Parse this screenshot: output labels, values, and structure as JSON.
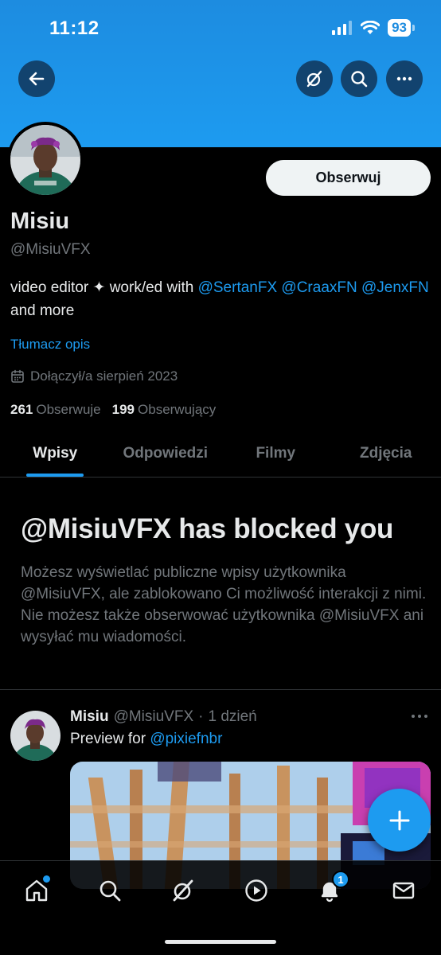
{
  "status_bar": {
    "time": "11:12",
    "battery": "93"
  },
  "profile": {
    "display_name": "Misiu",
    "handle": "@MisiuVFX",
    "follow_label": "Obserwuj",
    "bio_text": "video editor ✦ work/ed with ",
    "bio_mentions": [
      "@SertanFX",
      "@CraaxFN",
      "@JenxFN"
    ],
    "bio_suffix": " and more",
    "translate_label": "Tłumacz opis",
    "joined": "Dołączył/a sierpień 2023",
    "following_count": "261",
    "following_label": "Obserwuje",
    "followers_count": "199",
    "followers_label": "Obserwujący"
  },
  "tabs": [
    {
      "label": "Wpisy",
      "active": true
    },
    {
      "label": "Odpowiedzi",
      "active": false
    },
    {
      "label": "Filmy",
      "active": false
    },
    {
      "label": "Zdjęcia",
      "active": false
    }
  ],
  "blocked": {
    "title": "@MisiuVFX has blocked you",
    "description": "Możesz wyświetlać publiczne wpisy użytkownika @MisiuVFX, ale zablokowano Ci możliwość interakcji z nimi. Nie możesz także obserwować użytkownika @MisiuVFX ani wysyłać mu wiadomości."
  },
  "post": {
    "name": "Misiu",
    "handle": "@MisiuVFX",
    "separator": "·",
    "time": "1 dzień",
    "text": "Preview for ",
    "mention": "@pixiefnbr"
  },
  "bottom_nav": {
    "notification_count": "1"
  },
  "colors": {
    "accent": "#1d9bf0",
    "background": "#000000",
    "muted": "#71767b",
    "text": "#e7e9ea"
  }
}
